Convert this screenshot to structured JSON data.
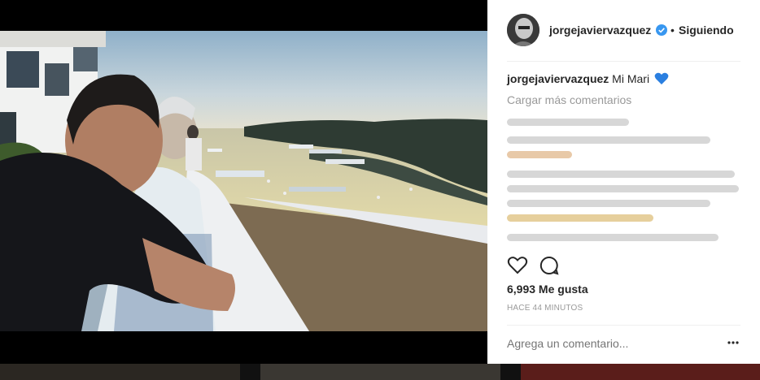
{
  "post": {
    "username": "jorgejaviervazquez",
    "separator": "•",
    "follow_label": "Siguiendo",
    "caption_user": "jorgejaviervazquez",
    "caption_text": "Mi Mari",
    "load_more_label": "Cargar más comentarios",
    "likes": "6,993 Me gusta",
    "time_ago": "HACE 44 MINUTOS",
    "comment_placeholder": "Agrega un comentario..."
  },
  "icons": {
    "verified": "verified-badge-icon",
    "heart_emoji": "blue-heart-icon",
    "like": "heart-outline-icon",
    "comment": "comment-bubble-icon",
    "more": "more-options-icon"
  },
  "colors": {
    "verified_blue": "#3897f0",
    "heart_blue": "#2a7fe0",
    "text": "#262626",
    "muted": "#999999"
  }
}
